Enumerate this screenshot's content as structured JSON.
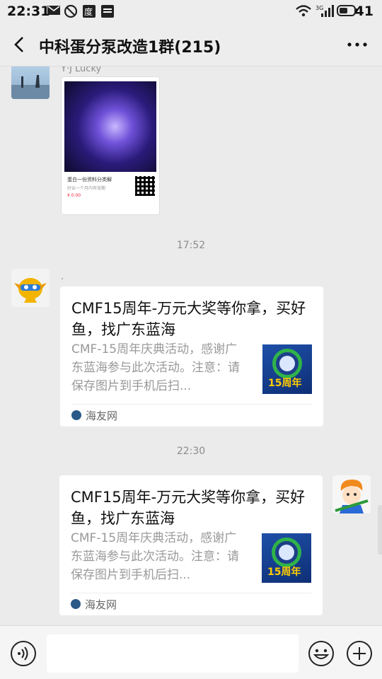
{
  "status_bar": {
    "time": "22:31",
    "battery": "41",
    "signal_label": "3G"
  },
  "header": {
    "title": "中科蛋分泵改造1群(215)"
  },
  "messages": {
    "m1": {
      "sender": "Y·J Lucky",
      "image_caption": "蛋白一份资料分类解",
      "image_sub": "好云一个月内有效期",
      "image_price": "¥ 0.00"
    },
    "t1": "17:52",
    "m2": {
      "sender": ".",
      "title": "CMF15周年-万元大奖等你拿，买好鱼，找广东蓝海",
      "desc": "CMF-15周年庆典活动，感谢广东蓝海参与此次活动。注意：请保存图片到手机后扫...",
      "source": "海友网",
      "thumb_badge": "15周年"
    },
    "t2": "22:30",
    "m3": {
      "title": "CMF15周年-万元大奖等你拿，买好鱼，找广东蓝海",
      "desc": "CMF-15周年庆典活动，感谢广东蓝海参与此次活动。注意：请保存图片到手机后扫...",
      "source": "海友网",
      "thumb_badge": "15周年"
    }
  },
  "input": {
    "value": "",
    "placeholder": ""
  },
  "colors": {
    "background": "#ebebeb",
    "header": "#ededed",
    "card": "#ffffff",
    "muted": "#8c8c8c"
  }
}
